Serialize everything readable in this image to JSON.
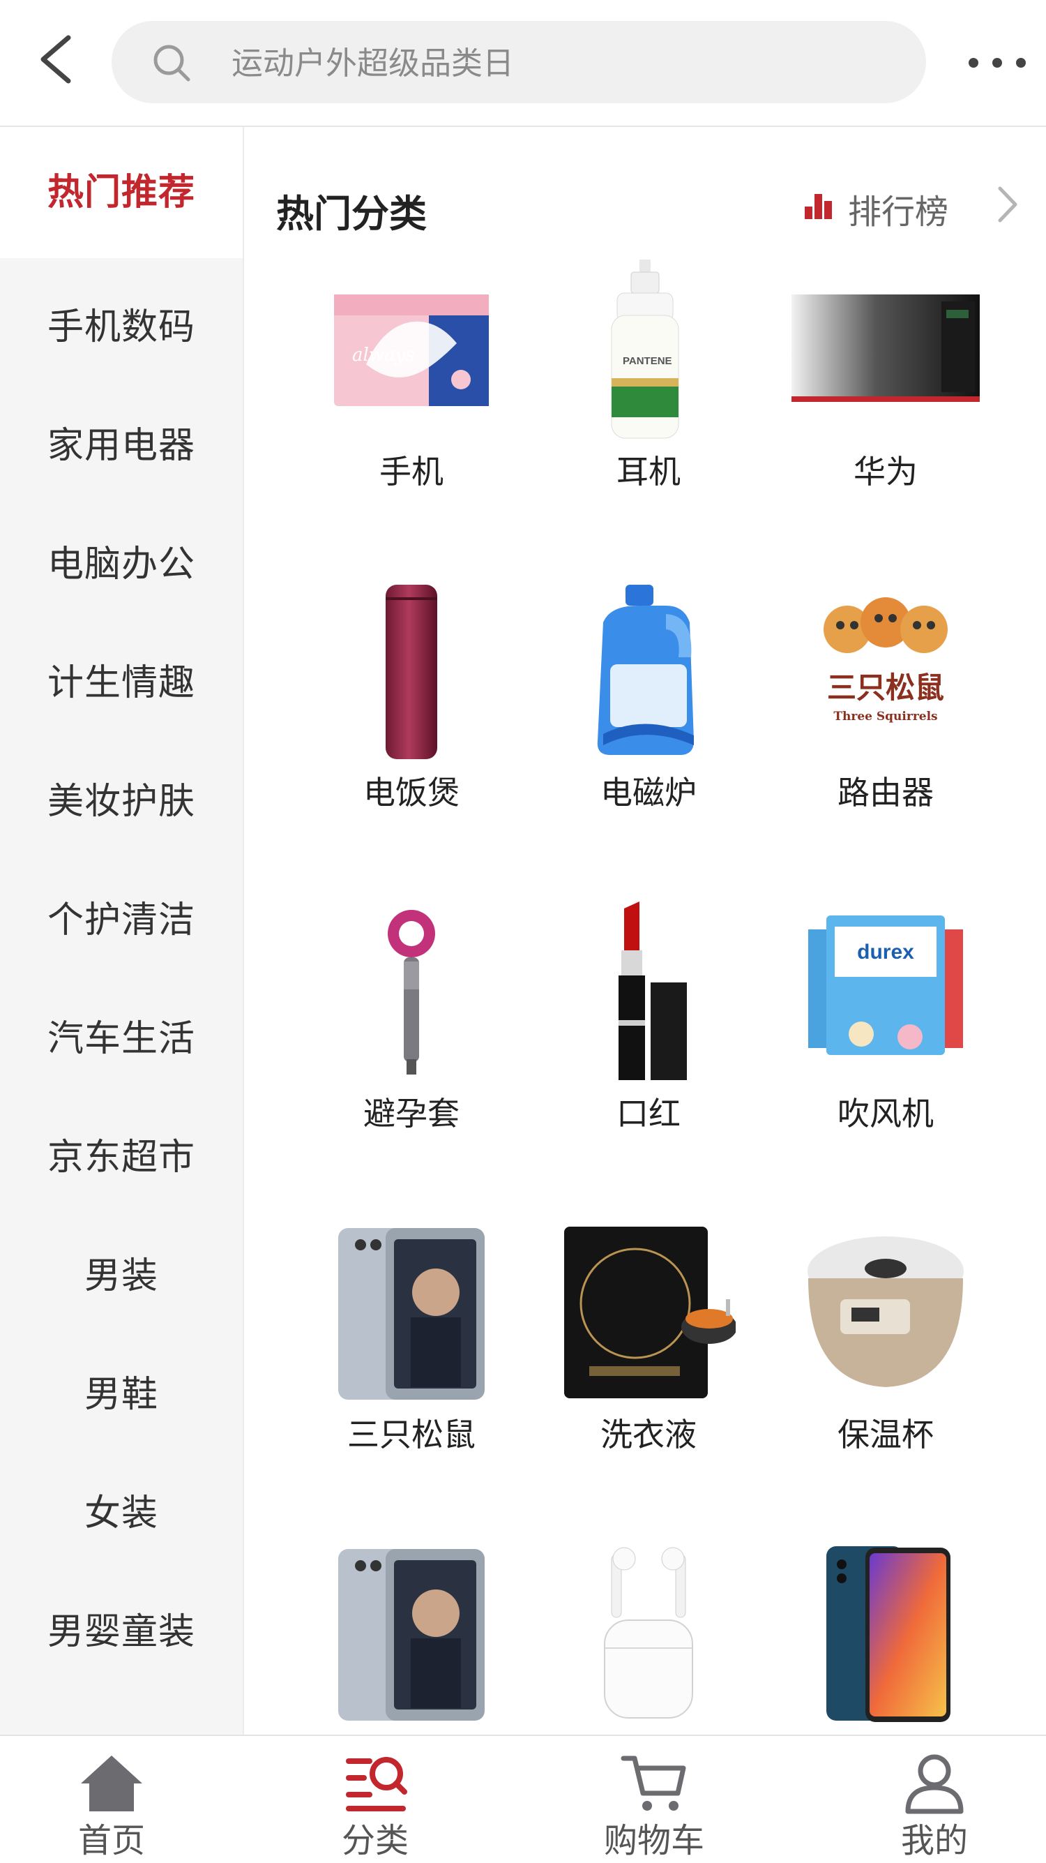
{
  "search": {
    "placeholder": "运动户外超级品类日"
  },
  "sidebar": {
    "active_index": 0,
    "items": [
      {
        "label": "热门推荐"
      },
      {
        "label": "手机数码"
      },
      {
        "label": "家用电器"
      },
      {
        "label": "电脑办公"
      },
      {
        "label": "计生情趣"
      },
      {
        "label": "美妆护肤"
      },
      {
        "label": "个护清洁"
      },
      {
        "label": "汽车生活"
      },
      {
        "label": "京东超市"
      },
      {
        "label": "男装"
      },
      {
        "label": "男鞋"
      },
      {
        "label": "女装"
      },
      {
        "label": "男婴童装"
      }
    ]
  },
  "main": {
    "section_title": "热门分类",
    "rank_label": "排行榜",
    "categories": [
      {
        "label": "手机",
        "image": "sanitary-pad-box"
      },
      {
        "label": "耳机",
        "image": "shampoo-bottle"
      },
      {
        "label": "华为",
        "image": "microwave-oven"
      },
      {
        "label": "电饭煲",
        "image": "thermos-cup"
      },
      {
        "label": "电磁炉",
        "image": "laundry-detergent"
      },
      {
        "label": "路由器",
        "image": "three-squirrels-logo",
        "image_text": [
          "三只松鼠",
          "Three Squirrels"
        ]
      },
      {
        "label": "避孕套",
        "image": "hair-dryer"
      },
      {
        "label": "口红",
        "image": "lipstick"
      },
      {
        "label": "吹风机",
        "image": "condom-boxes",
        "image_text": [
          "durex"
        ]
      },
      {
        "label": "三只松鼠",
        "image": "smartphone-poster"
      },
      {
        "label": "洗衣液",
        "image": "induction-cooker"
      },
      {
        "label": "保温杯",
        "image": "rice-cooker"
      },
      {
        "label": "",
        "image": "smartphone-poster"
      },
      {
        "label": "",
        "image": "earbuds-case"
      },
      {
        "label": "",
        "image": "huawei-phone"
      }
    ]
  },
  "tabbar": {
    "active_index": 1,
    "items": [
      {
        "label": "首页",
        "icon": "home-icon"
      },
      {
        "label": "分类",
        "icon": "category-search-icon"
      },
      {
        "label": "购物车",
        "icon": "cart-icon"
      },
      {
        "label": "我的",
        "icon": "user-icon"
      }
    ]
  },
  "colors": {
    "accent": "#c2272d",
    "sidebar_bg": "#f5f5f5",
    "search_bg": "#f0f0f0"
  }
}
